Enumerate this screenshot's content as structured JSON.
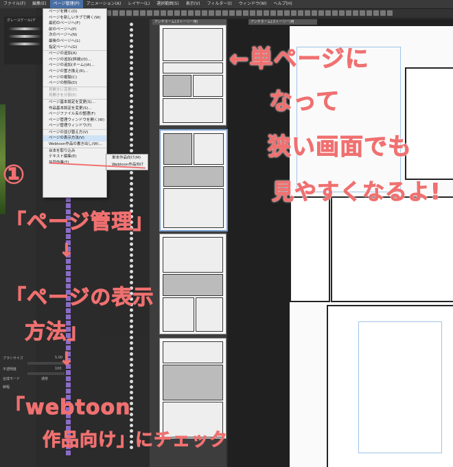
{
  "menubar": {
    "items": [
      "ファイル(F)",
      "編集(E)",
      "ページ管理(P)",
      "アニメーション(A)",
      "レイヤー(L)",
      "選択範囲(S)",
      "表示(V)",
      "フィルター(I)",
      "ウィンドウ(W)",
      "ヘルプ(H)"
    ]
  },
  "tabs": {
    "left": "アンチホーム(ストーリー用)",
    "right": "アンチホーム(ストーリー)用"
  },
  "brush_panel": {
    "title": "グレースケール(デ"
  },
  "page_menu": {
    "items": [
      {
        "label": "ページを開く(O)",
        "state": "normal"
      },
      {
        "label": "ページを新しいタブで開く(W)",
        "state": "normal"
      },
      {
        "label": "最初のページへ(F)",
        "state": "normal"
      },
      {
        "label": "前のページへ(P)",
        "state": "normal"
      },
      {
        "label": "次のページへ(N)",
        "state": "normal"
      },
      {
        "label": "最後のページへ(L)",
        "state": "normal"
      },
      {
        "label": "指定ページへ(G)",
        "state": "normal"
      },
      {
        "label": "ページの追加(A)",
        "state": "normal"
      },
      {
        "label": "ページの追加(詳細)(D)...",
        "state": "normal"
      },
      {
        "label": "ページの追加(ネーム)(A)...",
        "state": "normal"
      },
      {
        "label": "ページの置き換え(R)...",
        "state": "normal"
      },
      {
        "label": "ページの複製(C)",
        "state": "normal"
      },
      {
        "label": "ページの削除(D)",
        "state": "normal"
      },
      {
        "label": "見開きに変更(D)",
        "state": "dim"
      },
      {
        "label": "見開きを分割(E)",
        "state": "dim"
      },
      {
        "label": "ページ基本設定を変更(S)...",
        "state": "normal"
      },
      {
        "label": "作品基本設定を変更(S)...",
        "state": "normal"
      },
      {
        "label": "ページファイル名の整理(F)",
        "state": "normal"
      },
      {
        "label": "ページ管理ウィンドウを開く(W)",
        "state": "normal"
      },
      {
        "label": "ページ管理ウィンドウ(T)",
        "state": "normal"
      },
      {
        "label": "ページの並び替え方(V)",
        "state": "normal"
      },
      {
        "label": "ページの表示方法(V)",
        "state": "highlight"
      },
      {
        "label": "Webtoon作品の書き出し(W)...",
        "state": "normal"
      },
      {
        "label": "台本を取り込み",
        "state": "normal"
      },
      {
        "label": "テキスト編集(E)",
        "state": "normal"
      },
      {
        "label": "共同作業(T)",
        "state": "normal"
      }
    ]
  },
  "display_submenu": {
    "items": [
      "単本作品向け(M)",
      "Webtoon作品向け"
    ]
  },
  "tool_props": {
    "brush_size_label": "ブラシサイズ",
    "brush_size_value": "5.00",
    "opacity_label": "不透明度",
    "opacity_value": "100",
    "blend_label": "合成モード",
    "blend_value": "通常",
    "thickness_label": "線幅"
  },
  "annotations": {
    "arrow_text": "←単ページに",
    "line2": "なって",
    "line3": "狭い画面でも",
    "line4": "見やすくなるよ!",
    "step_number": "①",
    "step1": "「ページ管理」",
    "down1": "↓",
    "step2a": "「ページの表示",
    "step2b": "方法」",
    "down2": "↓",
    "step3a": "「webtoon",
    "step3b": "作品向け」にチェック"
  },
  "colors": {
    "annotation": "#f07070",
    "menu_highlight": "#cfe3f7",
    "menubar_active": "#4a6fa5"
  }
}
